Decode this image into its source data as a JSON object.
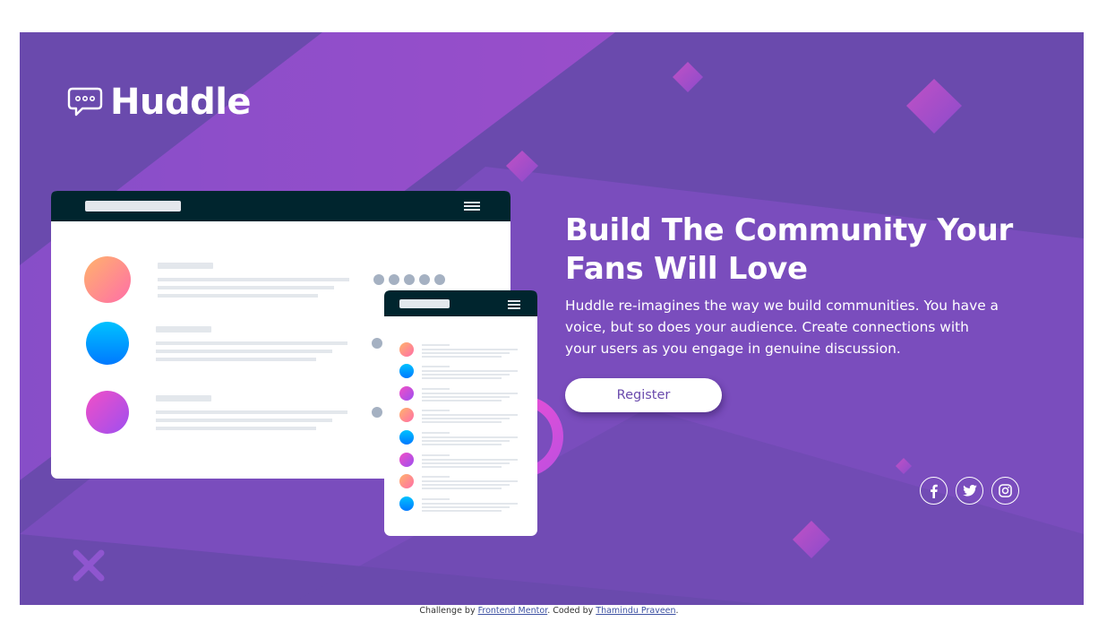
{
  "brand": {
    "name": "Huddle",
    "logo_icon": "speech-bubble-icon"
  },
  "hero": {
    "headline": "Build The Community Your Fans Will Love",
    "description": "Huddle re-imagines the way we build communities. You have a voice, but so does your audience. Create connections with your users as you engage in genuine discussion.",
    "register_label": "Register"
  },
  "socials": [
    {
      "name": "facebook",
      "icon": "facebook-icon"
    },
    {
      "name": "twitter",
      "icon": "twitter-icon"
    },
    {
      "name": "instagram",
      "icon": "instagram-icon"
    }
  ],
  "attribution": {
    "prefix": "Challenge by ",
    "link1": "Frontend Mentor",
    "middle": ". Coded by ",
    "link2": "Thamindu Praveen",
    "suffix": "."
  },
  "colors": {
    "background": "#6a4aad",
    "accent_magenta": "#e04fd2",
    "button_text": "#6a4aad",
    "mockup_header": "#00252e",
    "avatar_orange": "#ff9a71",
    "avatar_blue": "#00a2ff",
    "avatar_pink": "#d152e0"
  }
}
